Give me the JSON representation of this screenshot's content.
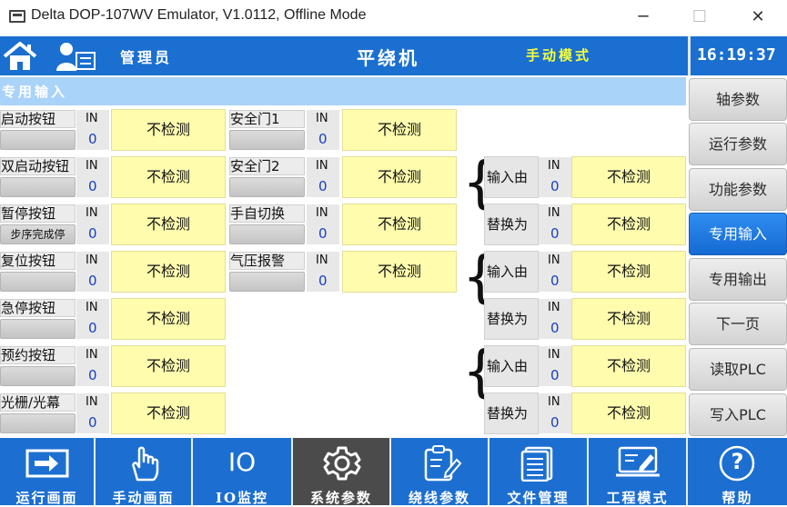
{
  "window": {
    "title": "Delta DOP-107WV Emulator, V1.0112, Offline Mode",
    "minimize": "─",
    "maximize": "☐",
    "close": "✕"
  },
  "header": {
    "role": "管理员",
    "machine": "平绕机",
    "mode": "手动模式",
    "time": "16:19:37",
    "mode_color": "#f6ff3a",
    "bg_color": "#1a6fd0"
  },
  "section_title": "专用输入",
  "in_label": "IN",
  "left_inputs": [
    {
      "label": "启动按钮",
      "value": "0",
      "status": "不检测"
    },
    {
      "label": "双启动按钮",
      "value": "0",
      "status": "不检测"
    },
    {
      "label": "暂停按钮",
      "sub": "步序完成停",
      "value": "0",
      "status": "不检测"
    },
    {
      "label": "复位按钮",
      "value": "0",
      "status": "不检测"
    },
    {
      "label": "急停按钮",
      "value": "0",
      "status": "不检测"
    },
    {
      "label": "预约按钮",
      "value": "0",
      "status": "不检测"
    },
    {
      "label": "光栅/光幕",
      "value": "0",
      "status": "不检测"
    }
  ],
  "mid_inputs": [
    {
      "label": "安全门1",
      "value": "0",
      "status": "不检测"
    },
    {
      "label": "安全门2",
      "value": "0",
      "status": "不检测"
    },
    {
      "label": "手自切换",
      "value": "0",
      "status": "不检测"
    },
    {
      "label": "气压报警",
      "value": "0",
      "status": "不检测"
    }
  ],
  "replace_groups": [
    {
      "from_label": "输入由",
      "to_label": "替换为",
      "from_value": "0",
      "to_value": "0",
      "from_status": "不检测",
      "to_status": "不检测"
    },
    {
      "from_label": "输入由",
      "to_label": "替换为",
      "from_value": "0",
      "to_value": "0",
      "from_status": "不检测",
      "to_status": "不检测"
    },
    {
      "from_label": "输入由",
      "to_label": "替换为",
      "from_value": "0",
      "to_value": "0",
      "from_status": "不检测",
      "to_status": "不检测"
    }
  ],
  "side_menu": [
    {
      "label": "轴参数",
      "active": false
    },
    {
      "label": "运行参数",
      "active": false
    },
    {
      "label": "功能参数",
      "active": false
    },
    {
      "label": "专用输入",
      "active": true
    },
    {
      "label": "专用输出",
      "active": false
    },
    {
      "label": "下一页",
      "active": false
    },
    {
      "label": "读取PLC",
      "active": false
    },
    {
      "label": "写入PLC",
      "active": false
    }
  ],
  "bottom_toolbar": [
    {
      "label": "运行画面",
      "icon": "enter-icon",
      "active": false
    },
    {
      "label": "手动画面",
      "icon": "hand-icon",
      "active": false
    },
    {
      "label": "IO监控",
      "icon": "io-icon",
      "icon_text": "IO",
      "active": false
    },
    {
      "label": "系统参数",
      "icon": "gear-icon",
      "active": true
    },
    {
      "label": "绕线参数",
      "icon": "clipboard-edit-icon",
      "active": false
    },
    {
      "label": "文件管理",
      "icon": "document-icon",
      "active": false
    },
    {
      "label": "工程模式",
      "icon": "engineering-icon",
      "active": false
    },
    {
      "label": "帮助",
      "icon": "help-icon",
      "icon_text": "?",
      "active": false
    }
  ],
  "colors": {
    "accent": "#1c6fd1",
    "active_tab": "#4b4b4b",
    "value_box": "#fffcae",
    "section_bar": "#a9d3f8"
  }
}
